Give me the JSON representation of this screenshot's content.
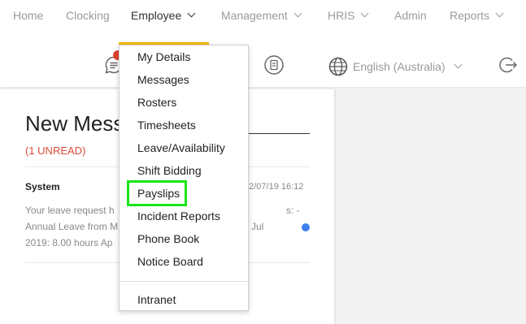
{
  "nav": {
    "items": [
      {
        "label": "Home",
        "has_dropdown": false
      },
      {
        "label": "Clocking",
        "has_dropdown": false
      },
      {
        "label": "Employee",
        "has_dropdown": true,
        "active": true
      },
      {
        "label": "Management",
        "has_dropdown": true
      },
      {
        "label": "HRIS",
        "has_dropdown": true
      },
      {
        "label": "Admin",
        "has_dropdown": false
      },
      {
        "label": "Reports",
        "has_dropdown": true
      }
    ],
    "active_bar_color": "#f5b700"
  },
  "toolbar": {
    "icons": [
      "messages-icon",
      "document-icon",
      "globe-icon",
      "logout-icon"
    ],
    "language": "English (Australia)",
    "badge_color": "#e0432f"
  },
  "panel": {
    "title": "New Mess",
    "unread": "(1 UNREAD)",
    "message": {
      "sender": "System",
      "date": "02/07/19 16:12",
      "body_lines": [
        "Your leave request h",
        "s: -",
        "Annual Leave from M",
        "9 Jul",
        "2019: 8.00 hours Ap"
      ]
    }
  },
  "dropdown": {
    "items": [
      "My Details",
      "Messages",
      "Rosters",
      "Timesheets",
      "Leave/Availability",
      "Shift Bidding",
      "Payslips",
      "Incident Reports",
      "Phone Book",
      "Notice Board"
    ],
    "extra_item": "Intranet",
    "highlighted": "Payslips",
    "highlight_color": "#19e619"
  }
}
